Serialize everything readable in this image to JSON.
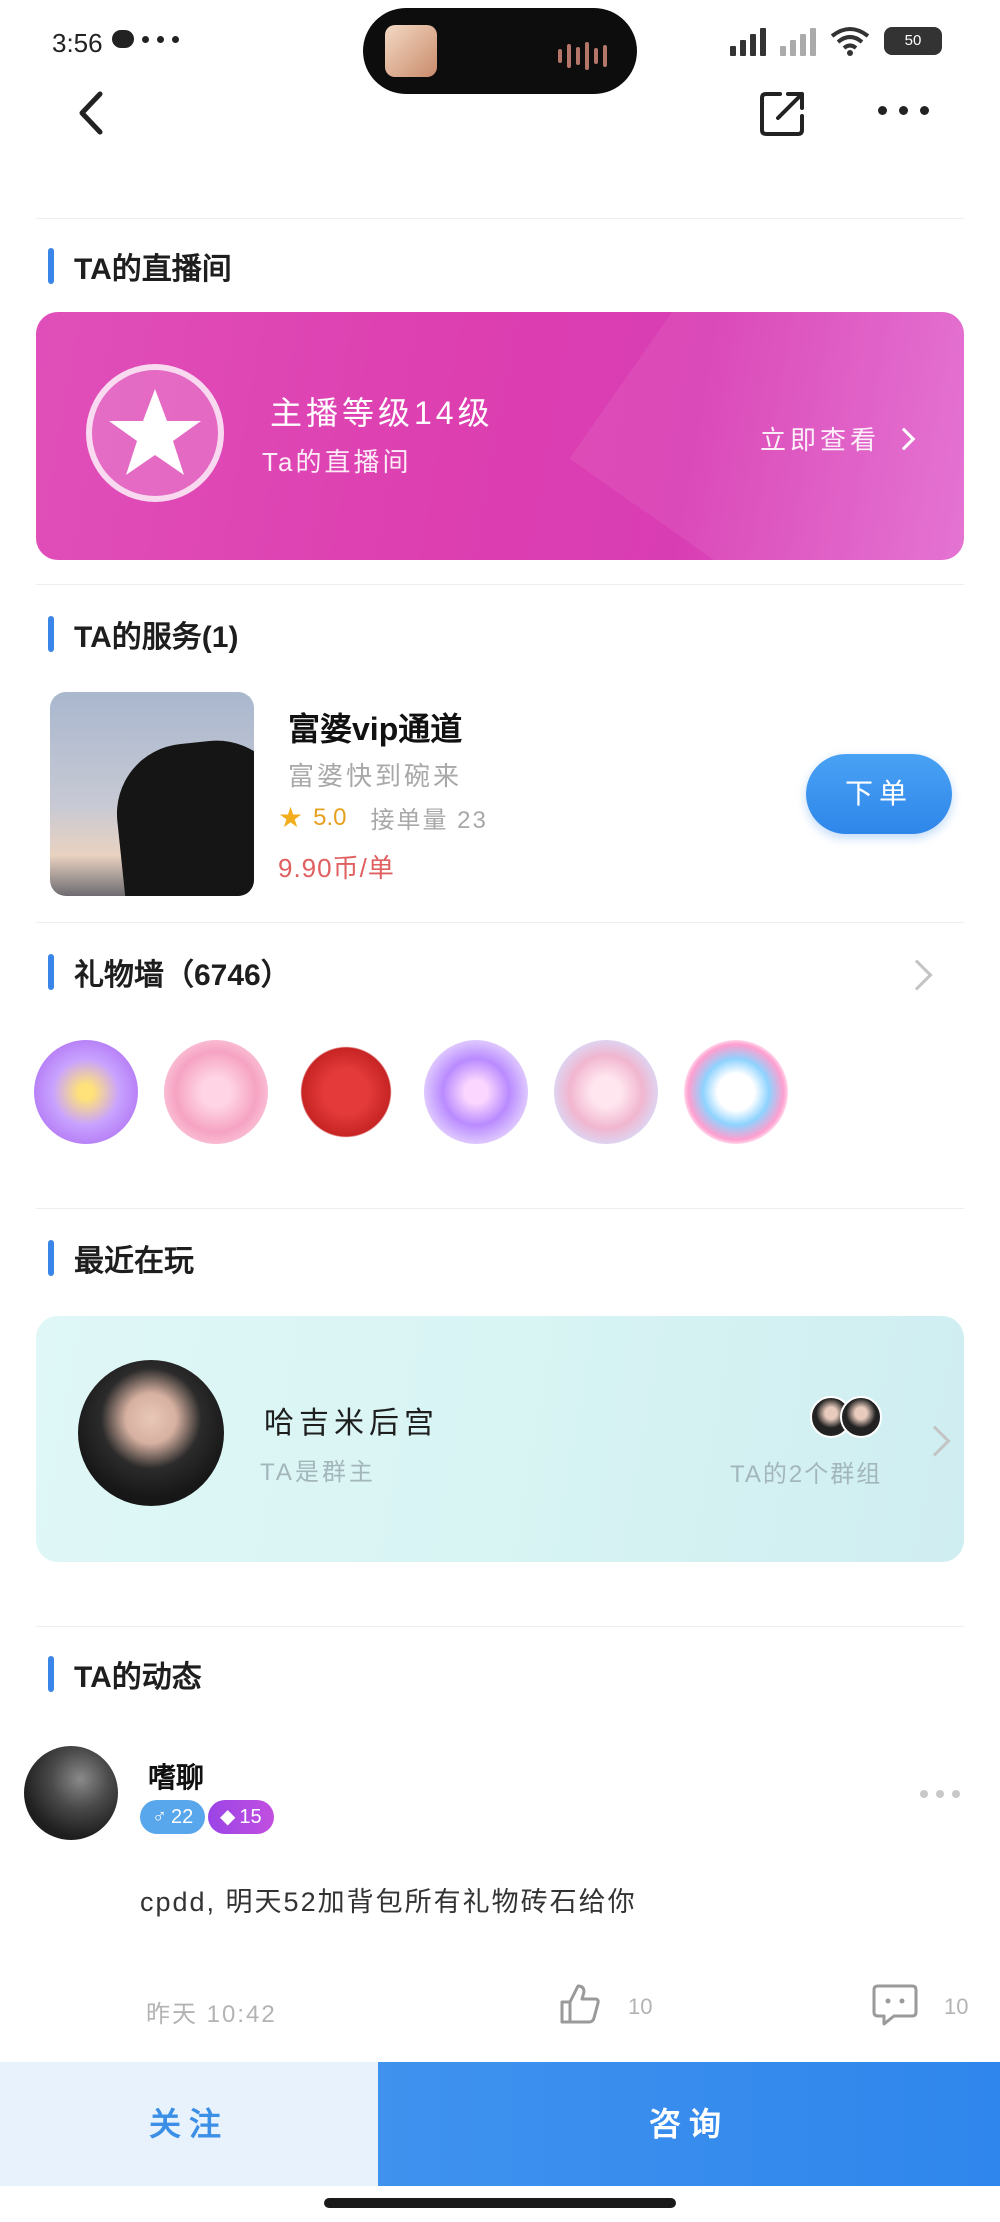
{
  "status_bar": {
    "time": "3:56",
    "network": "5G",
    "battery": "50"
  },
  "live_section": {
    "title": "TA的直播间",
    "level_text": "主播等级14级",
    "room_label": "Ta的直播间",
    "action_label": "立即查看"
  },
  "service_section": {
    "title": "TA的服务(1)",
    "item": {
      "name": "富婆vip通道",
      "description": "富婆快到碗来",
      "rating": "5.0",
      "sales": "接单量 23",
      "price": "9.90币/单",
      "order_label": "下单"
    }
  },
  "gift_section": {
    "title": "礼物墙（6746）",
    "gifts": [
      "gift-1",
      "gift-2",
      "heart-gift",
      "gift-4",
      "gift-5",
      "gift-6"
    ]
  },
  "playing_section": {
    "title": "最近在玩",
    "group_name": "哈吉米后宫",
    "group_role": "TA是群主",
    "group_count": "TA的2个群组"
  },
  "moments_section": {
    "title": "TA的动态",
    "post": {
      "username": "嗜聊",
      "gender_age": "22",
      "level": "15",
      "text": "cpdd, 明天52加背包所有礼物砖石给你",
      "time": "昨天 10:42",
      "likes": "10",
      "comments": "10"
    }
  },
  "bottom_bar": {
    "follow_label": "关注",
    "consult_label": "咨询"
  },
  "colors": {
    "accent": "#3a86e8",
    "live_card": "#dd3fb0",
    "price": "#e05f5f",
    "rating": "#f2ae1c"
  }
}
